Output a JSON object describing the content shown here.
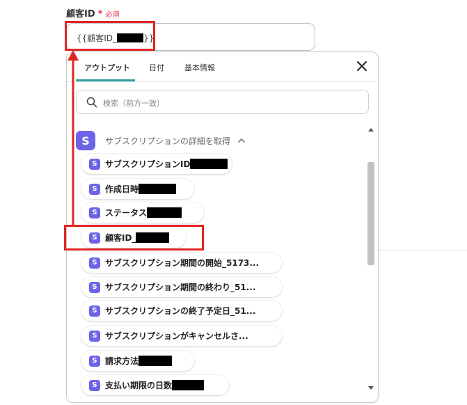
{
  "field": {
    "label": "顧客ID",
    "required_mark": "*",
    "required_text": "必須",
    "value_prefix": "{{顧客ID_",
    "value_suffix": "}}"
  },
  "dropdown": {
    "tabs": [
      {
        "label": "アウトプット",
        "active": true
      },
      {
        "label": "日付",
        "active": false
      },
      {
        "label": "基本情報",
        "active": false
      }
    ],
    "search_placeholder": "検索（前方一致）",
    "group": {
      "icon_letter": "S",
      "title": "サブスクリプションの詳細を取得"
    },
    "items": [
      {
        "label": "サブスクリプションID",
        "redacted": true
      },
      {
        "label": "作成日時",
        "redacted": true
      },
      {
        "label": "ステータス",
        "redacted": true
      },
      {
        "label": "顧客ID_",
        "redacted": true,
        "highlighted": true
      },
      {
        "label": "サブスクリプション期間の開始_5173...",
        "redacted": false
      },
      {
        "label": "サブスクリプション期間の終わり_51...",
        "redacted": false
      },
      {
        "label": "サブスクリプションの終了予定日_51...",
        "redacted": false
      },
      {
        "label": "サブスクリプションがキャンセルさ...",
        "redacted": false
      },
      {
        "label": "請求方法",
        "redacted": true
      },
      {
        "label": "支払い期限の日数",
        "redacted": true
      }
    ]
  },
  "colors": {
    "accent_tab": "#2f9ea0",
    "brand_icon": "#6c63e6",
    "annotation": "#e02424",
    "required": "#e0364d"
  }
}
